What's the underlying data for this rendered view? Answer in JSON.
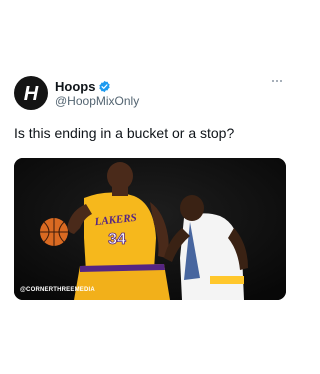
{
  "author": {
    "display_name": "Hoops",
    "handle": "@HoopMixOnly",
    "avatar_letter": "H",
    "verified": true
  },
  "tweet": {
    "text": "Is this ending in a bucket or a stop?"
  },
  "media": {
    "watermark": "@CORNERTHREEMEDIA",
    "jersey_left_team": "LAKERS",
    "jersey_left_number": "34"
  },
  "icons": {
    "verified": "verified-badge-icon",
    "more": "more-options-icon",
    "avatar": "hoops-logo-icon"
  },
  "colors": {
    "verified_blue": "#1d9bf0",
    "lakers_gold": "#f6b81c",
    "lakers_purple": "#552583",
    "handle_grey": "#536471"
  }
}
